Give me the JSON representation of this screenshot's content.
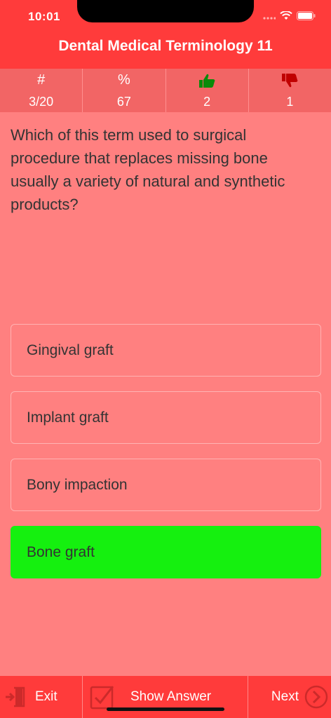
{
  "status": {
    "time": "10:01"
  },
  "nav": {
    "title": "Dental Medical Terminology 11"
  },
  "stats": [
    {
      "head": "#",
      "value": "3/20",
      "icon": "hash-icon"
    },
    {
      "head": "%",
      "value": "67",
      "icon": "percent-icon"
    },
    {
      "head": "",
      "value": "2",
      "icon": "thumbs-up-icon"
    },
    {
      "head": "",
      "value": "1",
      "icon": "thumbs-down-icon"
    }
  ],
  "question": "Which of this term used to surgical procedure that replaces missing bone usually a variety of natural and synthetic products?",
  "answers": [
    {
      "label": "Gingival graft"
    },
    {
      "label": "Implant graft"
    },
    {
      "label": "Bony impaction"
    },
    {
      "label": "Bone graft"
    }
  ],
  "toolbar": {
    "exit": "Exit",
    "show_answer": "Show Answer",
    "next": "Next"
  },
  "colors": {
    "header": "#FF3B3B",
    "background": "#FF8080",
    "correct": "#15F00F",
    "thumbs_up": "#0A8A0A",
    "thumbs_down": "#C00000"
  }
}
